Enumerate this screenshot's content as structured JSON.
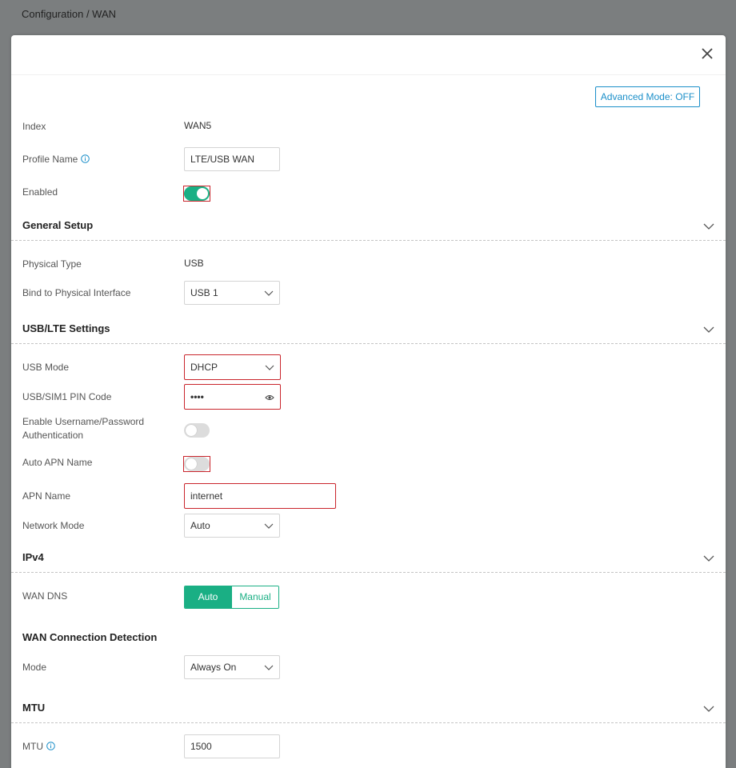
{
  "breadcrumb": "Configuration / WAN",
  "advanced_mode_label": "Advanced Mode: OFF",
  "fields": {
    "index_label": "Index",
    "index_value": "WAN5",
    "profile_name_label": "Profile Name",
    "profile_name_value": "LTE/USB WAN",
    "enabled_label": "Enabled",
    "enabled_on": true
  },
  "general_setup": {
    "title": "General Setup",
    "physical_type_label": "Physical Type",
    "physical_type_value": "USB",
    "bind_interface_label": "Bind to Physical Interface",
    "bind_interface_value": "USB 1"
  },
  "usb_lte": {
    "title": "USB/LTE Settings",
    "usb_mode_label": "USB Mode",
    "usb_mode_value": "DHCP",
    "pin_label": "USB/SIM1 PIN Code",
    "pin_value": "••••",
    "auth_label": "Enable Username/Password Authentication",
    "auth_on": false,
    "auto_apn_label": "Auto APN Name",
    "auto_apn_on": false,
    "apn_label": "APN Name",
    "apn_value": "internet",
    "network_mode_label": "Network Mode",
    "network_mode_value": "Auto"
  },
  "ipv4": {
    "title": "IPv4",
    "wan_dns_label": "WAN DNS",
    "dns_options": [
      "Auto",
      "Manual"
    ],
    "dns_selected": "Auto"
  },
  "detection": {
    "title": "WAN Connection Detection",
    "mode_label": "Mode",
    "mode_value": "Always On"
  },
  "mtu": {
    "title": "MTU",
    "mtu_label": "MTU",
    "mtu_value": "1500"
  },
  "colors": {
    "accent_green": "#1aaf84",
    "link_blue": "#1b8fc9",
    "error_red": "#c9252c"
  },
  "icons": {
    "close": "close-icon",
    "info": "info-icon",
    "chevron": "chevron-down-icon",
    "eye": "eye-icon"
  }
}
